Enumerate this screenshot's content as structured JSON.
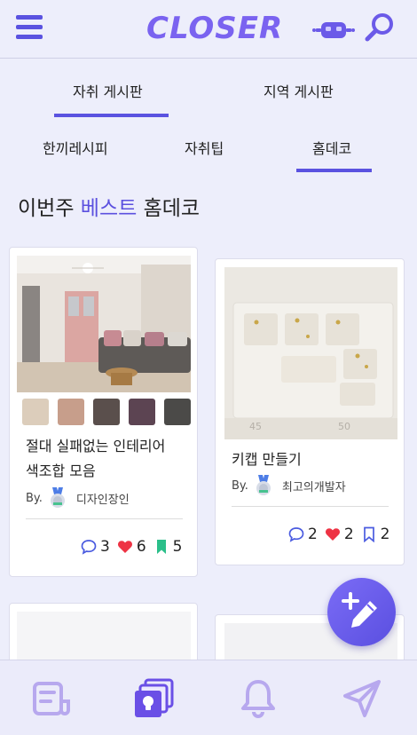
{
  "app": {
    "logo_text": "CLOSER"
  },
  "main_tabs": [
    {
      "label": "자취 게시판",
      "active": true
    },
    {
      "label": "지역 게시판",
      "active": false
    }
  ],
  "sub_tabs": [
    {
      "label": "한끼레시피",
      "active": false
    },
    {
      "label": "자취팁",
      "active": false
    },
    {
      "label": "홈데코",
      "active": true
    }
  ],
  "section": {
    "title_prefix": "이번주",
    "title_accent": "베스트",
    "title_suffix": "홈데코"
  },
  "cards": [
    {
      "title_line1": "절대 실패없는 인테리어",
      "title_line2": "색조합 모음",
      "by_label": "By.",
      "author": "디자인장인",
      "comments": "3",
      "likes": "6",
      "bookmarks": "5",
      "swatches": [
        "#dccdbb",
        "#c79e8b",
        "#5a4f4c",
        "#5c4452",
        "#4b4a48"
      ]
    },
    {
      "title": "키캡 만들기",
      "by_label": "By.",
      "author": "최고의개발자",
      "comments": "2",
      "likes": "2",
      "bookmarks": "2",
      "image_text_left": "45",
      "image_text_right": "50"
    }
  ],
  "colors": {
    "accent": "#5a52e0",
    "heart": "#ee3344",
    "bookmark": "#2bbf8a"
  },
  "bottom_nav": [
    "board-icon",
    "cards-idea-icon",
    "bell-icon",
    "paper-plane-icon"
  ]
}
